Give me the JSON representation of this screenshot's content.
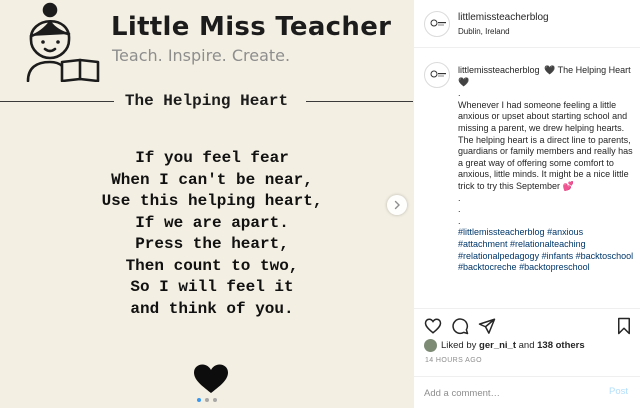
{
  "post_image": {
    "brand_title": "Little Miss Teacher",
    "brand_tagline": "Teach. Inspire. Create.",
    "poem_title": "The Helping Heart",
    "poem_lines": [
      "If you feel fear",
      "When I can't be near,",
      "Use this helping heart,",
      "If we are apart.",
      "Press the heart,",
      "Then count to two,",
      "So I will feel it",
      "and think of you."
    ],
    "carousel_dots": 3,
    "active_dot": 0
  },
  "header": {
    "username": "littlemissteacherblog",
    "location": "Dublin, Ireland"
  },
  "caption": {
    "username": "littlemissteacherblog",
    "first_line": "🖤 The Helping Heart 🖤",
    "dot1": ".",
    "body": "Whenever I had someone feeling a little anxious or upset about starting school and missing a parent, we drew helping hearts. The helping heart is a direct line to parents, guardians or family members and really has a great way of offering some comfort to anxious, little minds. It might be a nice little trick to try this September 💕",
    "dots": [
      ".",
      ".",
      "."
    ],
    "hashtags": [
      "#littlemissteacherblog",
      "#anxious",
      "#attachment",
      "#relationalteaching",
      "#relationalpedagogy",
      "#infants",
      "#backtoschool",
      "#backtocreche",
      "#backtopreschool"
    ]
  },
  "actions": {
    "liked_prefix": "Liked by",
    "liked_user": "ger_ni_t",
    "liked_mid": "and",
    "liked_others": "138 others",
    "timestamp": "14 HOURS AGO",
    "comment_placeholder": "Add a comment…",
    "post_label": "Post"
  },
  "icons": {
    "like": "heart-outline-icon",
    "comment": "comment-icon",
    "share": "paper-plane-icon",
    "save": "bookmark-icon",
    "next": "chevron-right-icon"
  },
  "colors": {
    "image_bg": "#f3efe3",
    "link_blue": "#00376b",
    "post_button": "#b2dffc",
    "dot_active": "#3897f0"
  }
}
